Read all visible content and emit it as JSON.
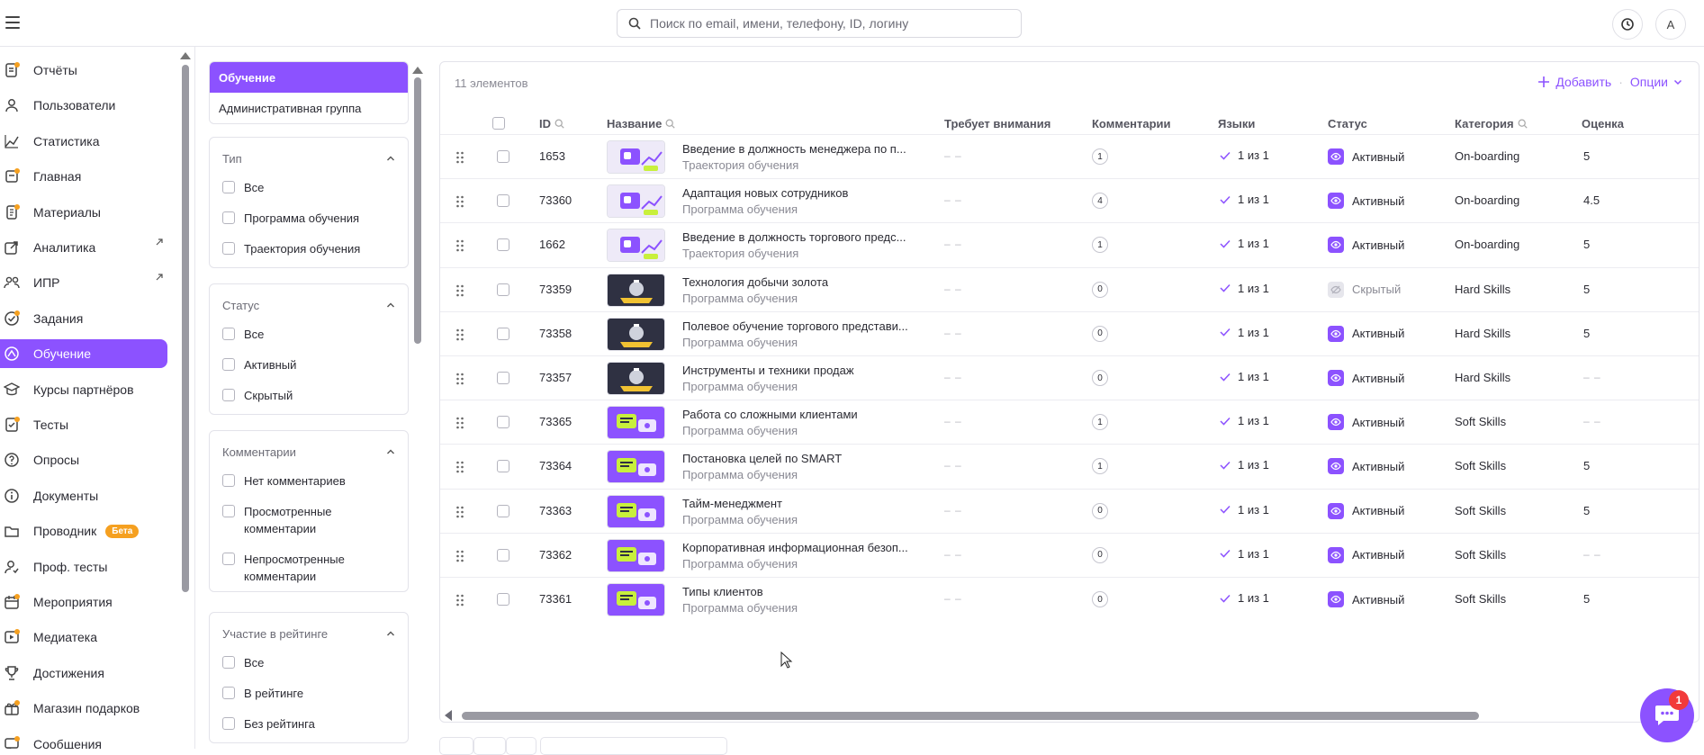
{
  "search": {
    "placeholder": "Поиск по email, имени, телефону, ID, логину"
  },
  "topbar": {
    "avatar_letter": "A"
  },
  "sidebar": {
    "items": [
      {
        "label": "Отчёты",
        "icon": "reports-icon",
        "dot": true
      },
      {
        "label": "Пользователи",
        "icon": "users-icon"
      },
      {
        "label": "Статистика",
        "icon": "chart-icon"
      },
      {
        "label": "Главная",
        "icon": "home-icon",
        "dot": true
      },
      {
        "label": "Материалы",
        "icon": "materials-icon",
        "dot": true
      },
      {
        "label": "Аналитика",
        "icon": "analytics-icon",
        "external": true
      },
      {
        "label": "ИПР",
        "icon": "ipr-icon",
        "external": true
      },
      {
        "label": "Задания",
        "icon": "tasks-icon",
        "dot": true
      },
      {
        "label": "Обучение",
        "icon": "learning-icon",
        "active": true
      },
      {
        "label": "Курсы партнёров",
        "icon": "partner-courses-icon"
      },
      {
        "label": "Тесты",
        "icon": "tests-icon",
        "dot": true
      },
      {
        "label": "Опросы",
        "icon": "polls-icon"
      },
      {
        "label": "Документы",
        "icon": "documents-icon"
      },
      {
        "label": "Проводник",
        "icon": "explorer-icon",
        "badge": "Бета"
      },
      {
        "label": "Проф. тесты",
        "icon": "prof-tests-icon"
      },
      {
        "label": "Мероприятия",
        "icon": "events-icon",
        "dot": true
      },
      {
        "label": "Медиатека",
        "icon": "media-icon",
        "dot": true
      },
      {
        "label": "Достижения",
        "icon": "trophy-icon"
      },
      {
        "label": "Магазин подарков",
        "icon": "gift-shop-icon",
        "dot": true
      },
      {
        "label": "Сообщения",
        "icon": "messages-icon",
        "dot": true
      }
    ]
  },
  "filters": {
    "tabs": [
      "Обучение",
      "Административная группа"
    ],
    "groups": [
      {
        "title": "Тип",
        "options": [
          "Все",
          "Программа обучения",
          "Траектория обучения"
        ]
      },
      {
        "title": "Статус",
        "options": [
          "Все",
          "Активный",
          "Скрытый"
        ]
      },
      {
        "title": "Комментарии",
        "options": [
          "Нет комментариев",
          "Просмотренные комментарии",
          "Непросмотренные комментарии"
        ]
      },
      {
        "title": "Участие в рейтинге",
        "options": [
          "Все",
          "В рейтинге",
          "Без рейтинга"
        ]
      }
    ]
  },
  "table": {
    "count_label": "11 элементов",
    "add_label": "Добавить",
    "options_label": "Опции",
    "columns": {
      "id": "ID",
      "name": "Название",
      "attention": "Требует внимания",
      "comments": "Комментарии",
      "languages": "Языки",
      "status": "Статус",
      "category": "Категория",
      "rating": "Оценка"
    },
    "rows": [
      {
        "id": "1653",
        "name": "Введение в должность менеджера по п...",
        "type": "Траектория обучения",
        "attention": "– –",
        "comments": "1",
        "languages": "1 из 1",
        "status": "Активный",
        "status_key": "active",
        "category": "On-boarding",
        "rating": "5",
        "thumb": "light"
      },
      {
        "id": "73360",
        "name": "Адаптация новых сотрудников",
        "type": "Программа обучения",
        "attention": "– –",
        "comments": "4",
        "languages": "1 из 1",
        "status": "Активный",
        "status_key": "active",
        "category": "On-boarding",
        "rating": "4.5",
        "thumb": "light"
      },
      {
        "id": "1662",
        "name": "Введение в должность торгового предс...",
        "type": "Траектория обучения",
        "attention": "– –",
        "comments": "1",
        "languages": "1 из 1",
        "status": "Активный",
        "status_key": "active",
        "category": "On-boarding",
        "rating": "5",
        "thumb": "light"
      },
      {
        "id": "73359",
        "name": "Технология добычи золота",
        "type": "Программа обучения",
        "attention": "– –",
        "comments": "0",
        "languages": "1 из 1",
        "status": "Скрытый",
        "status_key": "hidden",
        "category": "Hard Skills",
        "rating": "5",
        "thumb": "dark"
      },
      {
        "id": "73358",
        "name": "Полевое обучение торгового представи...",
        "type": "Программа обучения",
        "attention": "– –",
        "comments": "0",
        "languages": "1 из 1",
        "status": "Активный",
        "status_key": "active",
        "category": "Hard Skills",
        "rating": "5",
        "thumb": "dark"
      },
      {
        "id": "73357",
        "name": "Инструменты и техники продаж",
        "type": "Программа обучения",
        "attention": "– –",
        "comments": "0",
        "languages": "1 из 1",
        "status": "Активный",
        "status_key": "active",
        "category": "Hard Skills",
        "rating": "– –",
        "thumb": "dark"
      },
      {
        "id": "73365",
        "name": "Работа со сложными клиентами",
        "type": "Программа обучения",
        "attention": "– –",
        "comments": "1",
        "languages": "1 из 1",
        "status": "Активный",
        "status_key": "active",
        "category": "Soft Skills",
        "rating": "– –",
        "thumb": "purple"
      },
      {
        "id": "73364",
        "name": "Постановка целей по SMART",
        "type": "Программа обучения",
        "attention": "– –",
        "comments": "1",
        "languages": "1 из 1",
        "status": "Активный",
        "status_key": "active",
        "category": "Soft Skills",
        "rating": "5",
        "thumb": "purple"
      },
      {
        "id": "73363",
        "name": "Тайм-менеджмент",
        "type": "Программа обучения",
        "attention": "– –",
        "comments": "0",
        "languages": "1 из 1",
        "status": "Активный",
        "status_key": "active",
        "category": "Soft Skills",
        "rating": "5",
        "thumb": "purple"
      },
      {
        "id": "73362",
        "name": "Корпоративная информационная безоп...",
        "type": "Программа обучения",
        "attention": "– –",
        "comments": "0",
        "languages": "1 из 1",
        "status": "Активный",
        "status_key": "active",
        "category": "Soft Skills",
        "rating": "– –",
        "thumb": "purple"
      },
      {
        "id": "73361",
        "name": "Типы клиентов",
        "type": "Программа обучения",
        "attention": "– –",
        "comments": "0",
        "languages": "1 из 1",
        "status": "Активный",
        "status_key": "active",
        "category": "Soft Skills",
        "rating": "5",
        "thumb": "purple"
      }
    ]
  },
  "chat": {
    "unread": "1"
  },
  "colors": {
    "accent": "#8c52ff",
    "badge": "#f5a020",
    "alert": "#f23a3a"
  }
}
